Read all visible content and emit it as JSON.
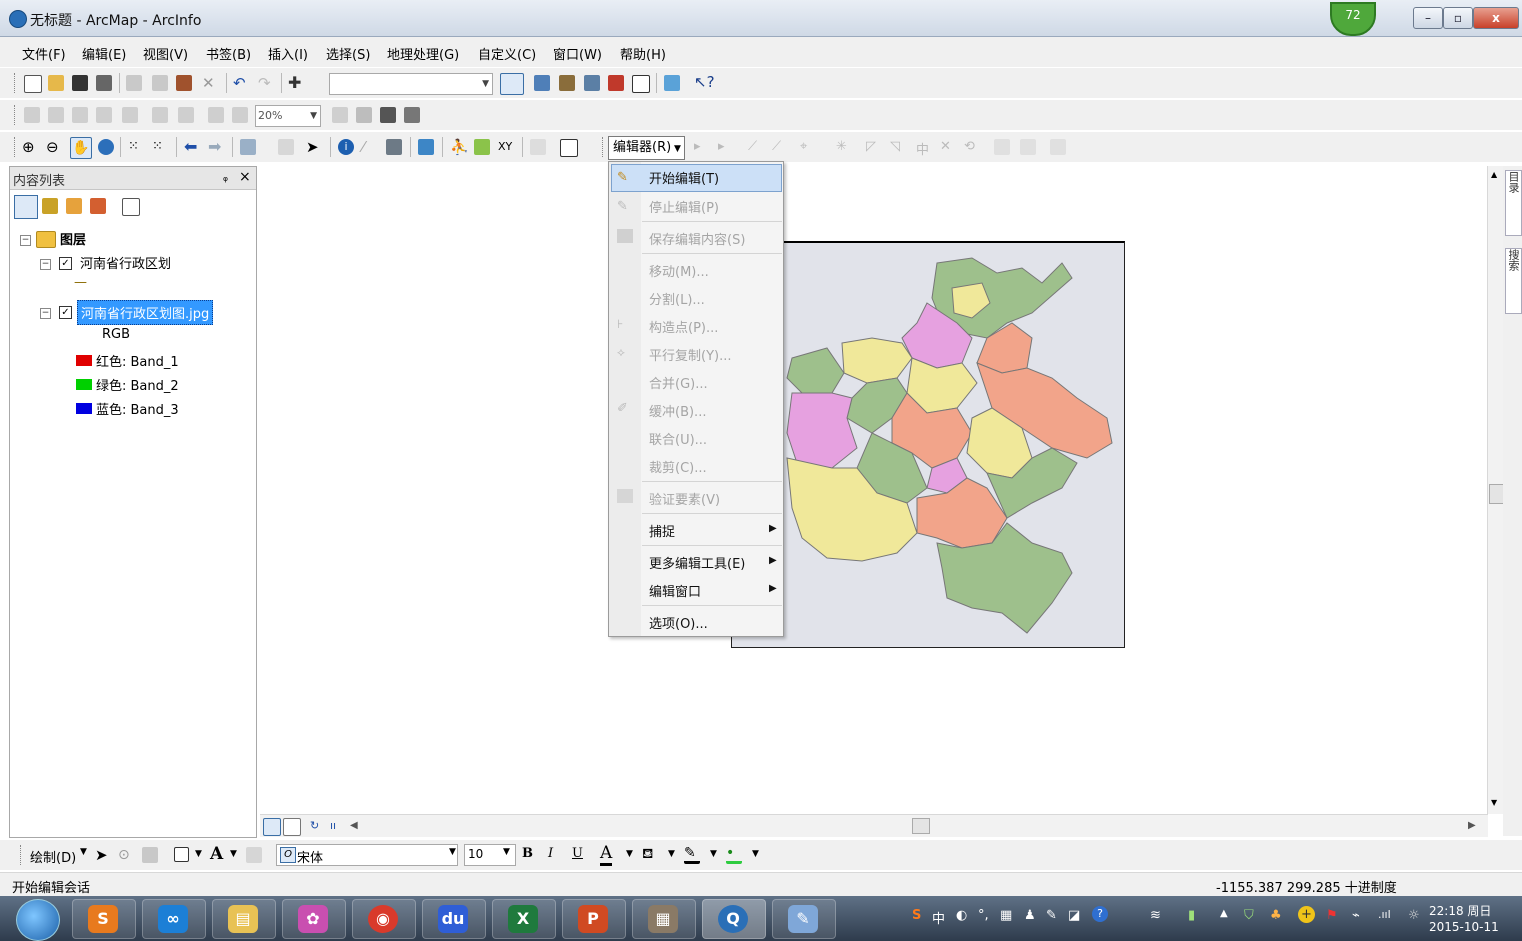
{
  "window": {
    "title": "无标题 - ArcMap - ArcInfo",
    "badge": "72",
    "min": "–",
    "max": "▫",
    "close": "x"
  },
  "menubar": [
    {
      "label": "文件(F)"
    },
    {
      "label": "编辑(E)"
    },
    {
      "label": "视图(V)"
    },
    {
      "label": "书签(B)"
    },
    {
      "label": "插入(I)"
    },
    {
      "label": "选择(S)"
    },
    {
      "label": "地理处理(G)"
    },
    {
      "label": "自定义(C)"
    },
    {
      "label": "窗口(W)"
    },
    {
      "label": "帮助(H)"
    }
  ],
  "toolbar2": {
    "zoom_value": "20%"
  },
  "editor_toolbar": {
    "label": "编辑器(R)"
  },
  "toc": {
    "title": "内容列表",
    "pin": "ᵩ",
    "close": "×",
    "root_label": "图层",
    "layers": [
      {
        "label": "河南省行政区划",
        "checked": true,
        "symbol": "—"
      },
      {
        "label": "河南省行政区划图.jpg",
        "checked": true,
        "selected": true,
        "rgb": "RGB",
        "bands": [
          {
            "label": "红色:   Band_1",
            "color": "#e00000"
          },
          {
            "label": "绿色: Band_2",
            "color": "#00d000"
          },
          {
            "label": "蓝色:   Band_3",
            "color": "#0000e0"
          }
        ]
      }
    ]
  },
  "editor_menu": {
    "items": [
      {
        "label": "开始编辑(T)",
        "enabled": true,
        "highlighted": true
      },
      {
        "label": "停止编辑(P)",
        "enabled": false
      },
      {
        "label": "保存编辑内容(S)",
        "enabled": false
      },
      {
        "label": "移动(M)...",
        "enabled": false
      },
      {
        "label": "分割(L)...",
        "enabled": false
      },
      {
        "label": "构造点(P)...",
        "enabled": false
      },
      {
        "label": "平行复制(Y)...",
        "enabled": false
      },
      {
        "label": "合并(G)...",
        "enabled": false
      },
      {
        "label": "缓冲(B)...",
        "enabled": false
      },
      {
        "label": "联合(U)...",
        "enabled": false
      },
      {
        "label": "裁剪(C)...",
        "enabled": false
      },
      {
        "label": "验证要素(V)",
        "enabled": false
      },
      {
        "label": "捕捉",
        "enabled": true,
        "submenu": true
      },
      {
        "label": "更多编辑工具(E)",
        "enabled": true,
        "submenu": true
      },
      {
        "label": "编辑窗口",
        "enabled": true,
        "submenu": true
      },
      {
        "label": "选项(O)...",
        "enabled": true
      }
    ]
  },
  "right_dock": {
    "tab1": "目录",
    "tab2": "搜索"
  },
  "drawing_toolbar": {
    "draw_label": "绘制(D)",
    "font_name": "宋体",
    "font_size": "10",
    "bold": "B",
    "italic": "I",
    "underline": "U",
    "font_color": "A"
  },
  "status": {
    "message": "开始编辑会话",
    "coords": "-1155.387  299.285 十进制度"
  },
  "taskbar": {
    "ime": "中",
    "time": "22:18 周日",
    "date": "2015-10-11"
  },
  "colors": {
    "highlight": "#cce0f7",
    "selection": "#3399ff",
    "map_green": "#9ec08c",
    "map_pink": "#e6a1e0",
    "map_yellow": "#f0e89a",
    "map_salmon": "#f2a48a"
  }
}
